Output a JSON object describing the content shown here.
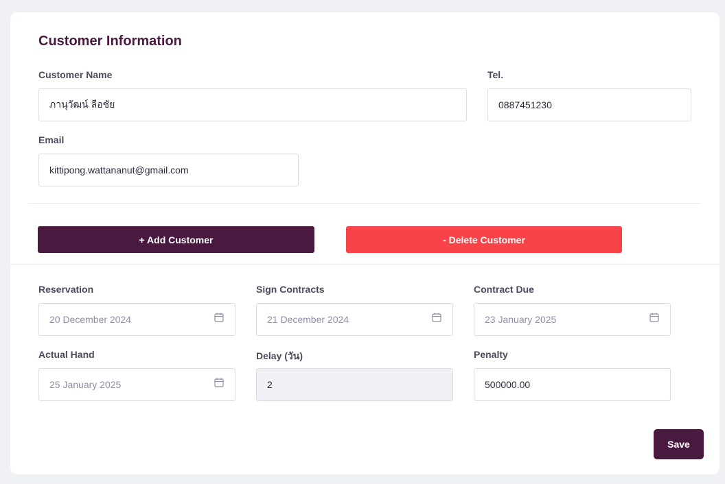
{
  "section": {
    "title": "Customer Information"
  },
  "customer": {
    "name_label": "Customer Name",
    "name_value": "ภานุวัฒน์ ลือชัย",
    "tel_label": "Tel.",
    "tel_value": "0887451230",
    "email_label": "Email",
    "email_value": "kittipong.wattananut@gmail.com"
  },
  "actions": {
    "add_label": "+ Add Customer",
    "delete_label": "- Delete Customer",
    "save_label": "Save"
  },
  "contract": {
    "reservation_label": "Reservation",
    "reservation_value": "20 December 2024",
    "sign_label": "Sign Contracts",
    "sign_value": "21 December 2024",
    "due_label": "Contract Due",
    "due_value": "23 January 2025",
    "actual_label": "Actual Hand",
    "actual_value": "25 January 2025",
    "delay_label": "Delay (วัน)",
    "delay_value": "2",
    "penalty_label": "Penalty",
    "penalty_value": "500000.00"
  },
  "icons": {
    "calendar": "calendar-icon"
  },
  "colors": {
    "brand": "#4a1940",
    "danger": "#f94349",
    "background": "#f0f1f5"
  }
}
